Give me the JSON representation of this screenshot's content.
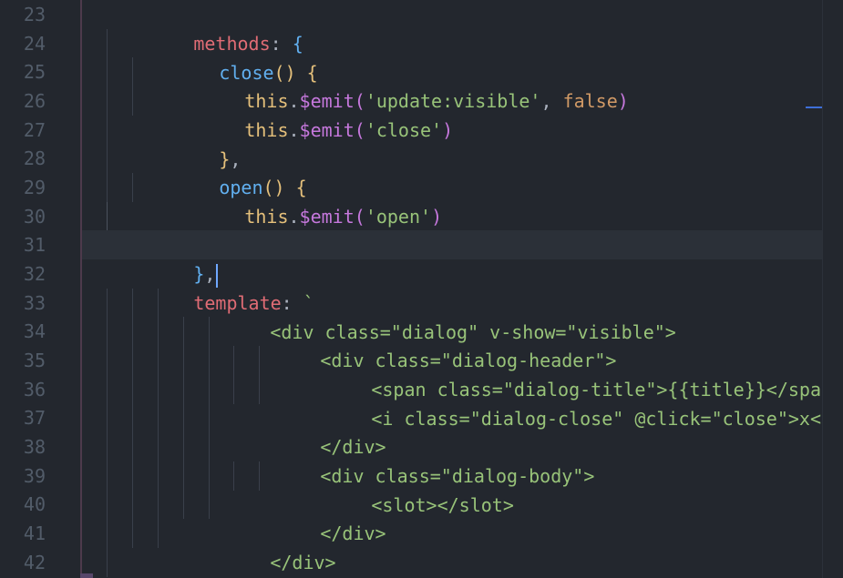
{
  "editor": {
    "accent_color": "#3e6fd8",
    "background_color": "#23272e",
    "line_numbers": [
      "23",
      "24",
      "25",
      "26",
      "27",
      "28",
      "29",
      "30",
      "31",
      "32",
      "33",
      "34",
      "35",
      "36",
      "37",
      "38",
      "39",
      "40",
      "41",
      "42"
    ],
    "active_line": "31"
  },
  "lines": [
    {
      "t": [
        "methods",
        ": ",
        "{"
      ]
    },
    {
      "t": [
        "close",
        "() ",
        "{"
      ]
    },
    {
      "t": [
        "this",
        ".",
        "$emit",
        "(",
        "'update:visible'",
        ", ",
        "false",
        ")"
      ]
    },
    {
      "t": [
        "this",
        ".",
        "$emit",
        "(",
        "'close'",
        ")"
      ]
    },
    {
      "t": [
        "}",
        ","
      ]
    },
    {
      "t": [
        "open",
        "() ",
        "{"
      ]
    },
    {
      "t": [
        "this",
        ".",
        "$emit",
        "(",
        "'open'",
        ")"
      ]
    },
    {
      "t": [
        "}"
      ]
    },
    {
      "t": [
        "}",
        ","
      ]
    },
    {
      "t": [
        "template",
        ": ",
        "`"
      ]
    },
    {
      "t": [
        "<div class=\"dialog\" v-show=\"visible\">"
      ]
    },
    {
      "t": [
        "<div class=\"dialog-header\">"
      ]
    },
    {
      "t": [
        "<span class=\"dialog-title\">{{title}}</span>"
      ]
    },
    {
      "t": [
        "<i class=\"dialog-close\" @click=\"close\">x</i"
      ]
    },
    {
      "t": [
        "</div>"
      ]
    },
    {
      "t": [
        "<div class=\"dialog-body\">"
      ]
    },
    {
      "t": [
        "<slot></slot>"
      ]
    },
    {
      "t": [
        "</div>"
      ]
    },
    {
      "t": [
        "</div>"
      ]
    },
    {
      "t": [
        "`",
        ","
      ]
    }
  ]
}
